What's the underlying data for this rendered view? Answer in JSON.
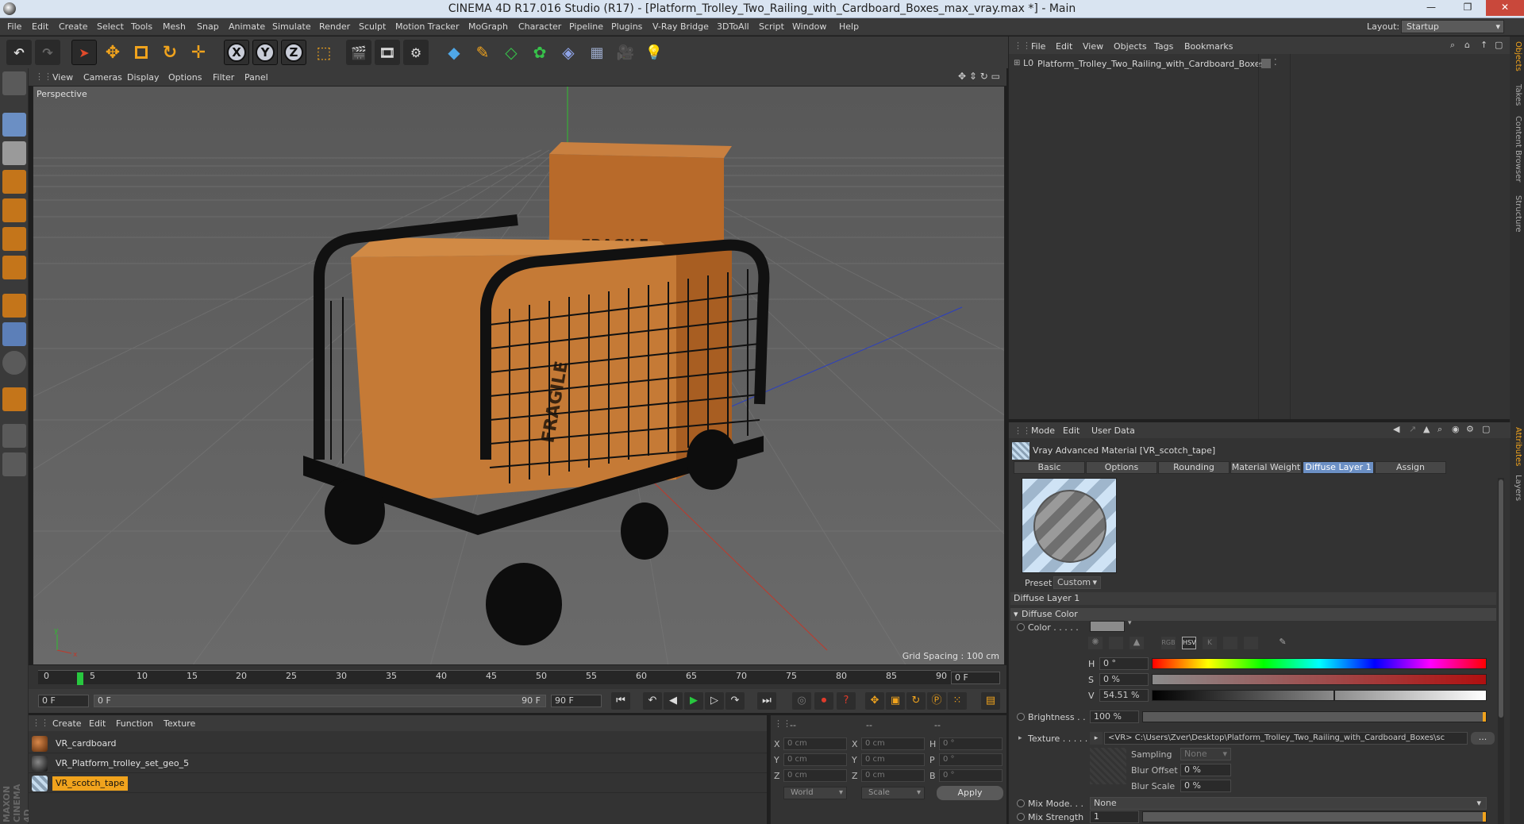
{
  "window": {
    "title": "CINEMA 4D R17.016 Studio (R17) - [Platform_Trolley_Two_Railing_with_Cardboard_Boxes_max_vray.max *] - Main",
    "minimize": "—",
    "restore": "❐",
    "close": "✕"
  },
  "menu": [
    "File",
    "Edit",
    "Create",
    "Select",
    "Tools",
    "Mesh",
    "Snap",
    "Animate",
    "Simulate",
    "Render",
    "Sculpt",
    "Motion Tracker",
    "MoGraph",
    "Character",
    "Pipeline",
    "Plugins",
    "V-Ray Bridge",
    "3DToAll",
    "Script",
    "Window",
    "Help"
  ],
  "layout": {
    "label": "Layout:",
    "value": "Startup"
  },
  "toolbar": {
    "x": "X",
    "y": "Y",
    "z": "Z"
  },
  "viewport": {
    "menu": [
      "View",
      "Cameras",
      "Display",
      "Options",
      "Filter",
      "Panel"
    ],
    "label": "Perspective",
    "grid_spacing": "Grid Spacing : 100 cm",
    "box_text": "FRAGILE"
  },
  "timeline": {
    "ticks": [
      "0",
      "5",
      "10",
      "15",
      "20",
      "25",
      "30",
      "35",
      "40",
      "45",
      "50",
      "55",
      "60",
      "65",
      "70",
      "75",
      "80",
      "85",
      "90"
    ],
    "current_frame": "0 F"
  },
  "transport": {
    "start": "0 F",
    "range_start": "0 F",
    "range_end": "90 F",
    "end": "90 F"
  },
  "material_manager": {
    "menu": [
      "Create",
      "Edit",
      "Function",
      "Texture"
    ],
    "materials": [
      {
        "name": "VR_cardboard",
        "selected": false
      },
      {
        "name": "VR_Platform_trolley_set_geo_5",
        "selected": false
      },
      {
        "name": "VR_scotch_tape",
        "selected": true
      }
    ]
  },
  "coordinates": {
    "headers": [
      "--",
      "--",
      "--"
    ],
    "rows": [
      {
        "a": "X",
        "av": "0 cm",
        "b": "X",
        "bv": "0 cm",
        "c": "H",
        "cv": "0 °"
      },
      {
        "a": "Y",
        "av": "0 cm",
        "b": "Y",
        "bv": "0 cm",
        "c": "P",
        "cv": "0 °"
      },
      {
        "a": "Z",
        "av": "0 cm",
        "b": "Z",
        "bv": "0 cm",
        "c": "B",
        "cv": "0 °"
      }
    ],
    "world": "World",
    "scale": "Scale",
    "apply": "Apply"
  },
  "object_manager": {
    "menu": [
      "File",
      "Edit",
      "View",
      "Objects",
      "Tags",
      "Bookmarks"
    ],
    "objects": [
      "Platform_Trolley_Two_Railing_with_Cardboard_Boxes"
    ]
  },
  "side_tabs": [
    "Objects",
    "Takes",
    "Content Browser",
    "Structure"
  ],
  "side_tabs_lower": [
    "Attributes",
    "Layers"
  ],
  "attributes": {
    "menu": [
      "Mode",
      "Edit",
      "User Data"
    ],
    "title": "Vray Advanced Material [VR_scotch_tape]",
    "tabs": [
      "Basic",
      "Options",
      "Rounding",
      "Material Weight",
      "Diffuse Layer 1",
      "Assign"
    ],
    "active_tab": "Diffuse Layer 1",
    "preset_label": "Preset",
    "preset_value": "Custom",
    "section": "Diffuse Layer 1",
    "subsection": "Diffuse Color",
    "color_label": "Color . . . . .",
    "hsv": {
      "h_label": "H",
      "h": "0 °",
      "s_label": "S",
      "s": "0 %",
      "v_label": "V",
      "v": "54.51 %"
    },
    "brightness_label": "Brightness . .",
    "brightness": "100 %",
    "texture_label": "Texture . . . . .",
    "texture_path": "<VR> C:\\Users\\Zver\\Desktop\\Platform_Trolley_Two_Railing_with_Cardboard_Boxes\\sc",
    "texture_more": "...",
    "sampling_label": "Sampling",
    "sampling_value": "None",
    "blur_offset_label": "Blur Offset",
    "blur_offset": "0 %",
    "blur_scale_label": "Blur Scale",
    "blur_scale": "0 %",
    "mix_mode_label": "Mix Mode. . .",
    "mix_mode": "None",
    "mix_strength_label": "Mix Strength",
    "mix_strength": "1"
  },
  "colors": {
    "accent": "#f0a31d",
    "selected_tab": "#6b8fc4",
    "timeline_cursor": "#28c73f"
  }
}
